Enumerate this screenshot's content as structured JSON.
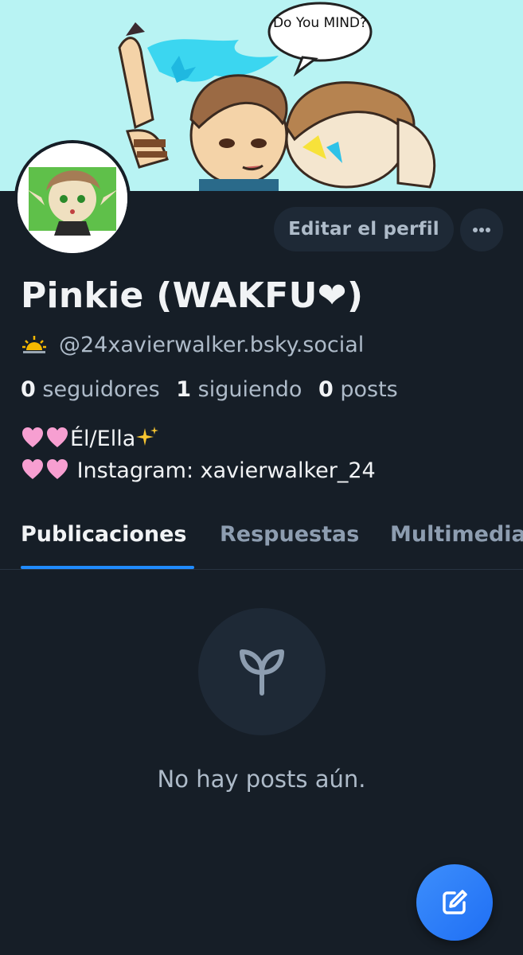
{
  "profile": {
    "banner_speech": "Do You MIND?",
    "display_name": "Pinkie (WAKFU❤)",
    "handle": "@24xavierwalker.bsky.social",
    "stats": {
      "followers_count": "0",
      "followers_label": "seguidores",
      "following_count": "1",
      "following_label": "siguiendo",
      "posts_count": "0",
      "posts_label": "posts"
    },
    "bio": {
      "line1_text": "Él/Ella",
      "line2_text": " Instagram: xavierwalker_24"
    }
  },
  "actions": {
    "edit_profile_label": "Editar el perfil"
  },
  "tabs": [
    {
      "label": "Publicaciones",
      "active": true
    },
    {
      "label": "Respuestas",
      "active": false
    },
    {
      "label": "Multimedia",
      "active": false
    }
  ],
  "empty_state": {
    "message": "No hay posts aún.",
    "icon": "seedling-icon"
  },
  "icons": {
    "more": "ellipsis-icon",
    "handle_badge": "sunrise-icon",
    "fab": "compose-icon"
  },
  "colors": {
    "background": "#161e27",
    "accent": "#208bfe",
    "muted_text": "#aebbc9",
    "button_bg": "#1e2936"
  }
}
